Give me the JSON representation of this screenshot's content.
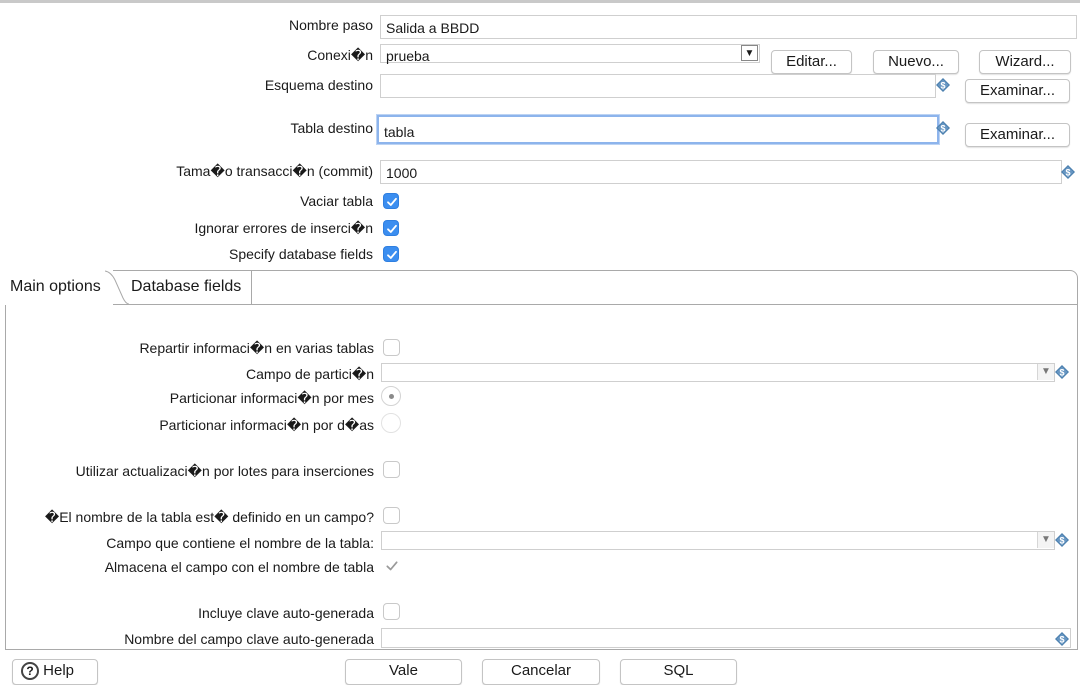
{
  "form": {
    "step_name": {
      "label": "Nombre paso",
      "value": "Salida a BBDD"
    },
    "connection": {
      "label": "Conexi�n",
      "value": "prueba",
      "edit": "Editar...",
      "new": "Nuevo...",
      "wizard": "Wizard..."
    },
    "target_schema": {
      "label": "Esquema destino",
      "value": "",
      "browse": "Examinar..."
    },
    "target_table": {
      "label": "Tabla destino",
      "value": "tabla",
      "browse": "Examinar..."
    },
    "commit_size": {
      "label": "Tama�o transacci�n (commit)",
      "value": "1000"
    },
    "truncate_table": {
      "label": "Vaciar tabla",
      "checked": true
    },
    "ignore_insert_errors": {
      "label": "Ignorar errores de inserci�n",
      "checked": true
    },
    "specify_db_fields": {
      "label": "Specify database fields",
      "checked": true
    }
  },
  "tabs": [
    {
      "label": "Main options",
      "active": true
    },
    {
      "label": "Database fields",
      "active": false
    }
  ],
  "main_options": {
    "partition_tables": {
      "label": "Repartir informaci�n en varias tablas",
      "checked": false
    },
    "partition_field": {
      "label": "Campo de partici�n",
      "value": ""
    },
    "partition_month": {
      "label": "Particionar informaci�n por mes",
      "selected": true
    },
    "partition_day": {
      "label": "Particionar informaci�n por d�as",
      "selected": false
    },
    "batch_updates": {
      "label": "Utilizar actualizaci�n por lotes para inserciones",
      "checked": false
    },
    "table_name_in_field": {
      "label": "�El nombre de la tabla est� definido en un campo?",
      "checked": false
    },
    "table_name_field": {
      "label": "Campo que contiene el nombre de la tabla:",
      "value": ""
    },
    "store_table_name_field": {
      "label": "Almacena el campo con el nombre de tabla",
      "checked": true
    },
    "autogen_key": {
      "label": "Incluye clave auto-generada",
      "checked": false
    },
    "autogen_key_field": {
      "label": "Nombre del campo clave auto-generada",
      "value": ""
    }
  },
  "footer": {
    "help": "Help",
    "ok": "Vale",
    "cancel": "Cancelar",
    "sql": "SQL"
  },
  "colors": {
    "accent": "#3b8ef0",
    "focus_ring": "#8db4ec",
    "variable_icon": "#4a7fae"
  }
}
